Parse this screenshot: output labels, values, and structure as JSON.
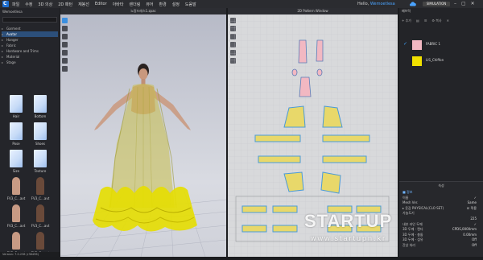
{
  "menubar": {
    "menus": [
      "파일",
      "수정",
      "3D 의상",
      "2D 패턴",
      "재봉선",
      "Editor",
      "아바타",
      "렌더링",
      "뷰어",
      "환경",
      "설정",
      "도움말"
    ],
    "user_greeting": "Hello, ",
    "user_name": "Wemoetlesa",
    "sim_button": "SIMULATION",
    "accent": "#1f6fd1"
  },
  "library": {
    "header": "Wemoetlesa",
    "tree": [
      "Garment",
      "Avatar",
      "Hanger",
      "Fabric",
      "Hardware and Trims",
      "Material",
      "Stage"
    ],
    "selected": "Avatar",
    "thumbs": [
      {
        "label": "Hair",
        "type": "file"
      },
      {
        "label": "Bottom",
        "type": "file"
      },
      {
        "label": "Pose",
        "type": "file"
      },
      {
        "label": "Shoes",
        "type": "file"
      },
      {
        "label": "Size",
        "type": "file"
      },
      {
        "label": "Texture",
        "type": "file"
      },
      {
        "label": "FV3_C...avt",
        "type": "avatar"
      },
      {
        "label": "FV3_C...avt",
        "type": "avatar"
      },
      {
        "label": "FV3_C...avt",
        "type": "avatar"
      },
      {
        "label": "FV3_C...avt",
        "type": "avatar"
      },
      {
        "label": "FV3_C...avt",
        "type": "avatar"
      },
      {
        "label": "FV3_C...avt",
        "type": "avatar"
      }
    ],
    "status": "Version: 7.0.238 (r38496)"
  },
  "viewport3d": {
    "title": "노랑드레스1.zpac",
    "toolbar_icons": [
      "select-icon",
      "move-icon",
      "pin-icon",
      "fold-icon",
      "brush-icon",
      "fabric-icon",
      "avatar-icon"
    ]
  },
  "viewport2d": {
    "title": "2D Pattern Window",
    "toolbar_icons": [
      "transform-icon",
      "edit-point-icon",
      "curve-icon",
      "seam-icon",
      "texture-icon",
      "pin-icon"
    ]
  },
  "object_browser": {
    "header": "패브릭",
    "tabs": [
      "+ 추가",
      "▤",
      "☰",
      "⚙ 복사",
      "✕"
    ],
    "fabrics": [
      {
        "name": "FABRIC 1",
        "color": "#f2b8c2",
        "checked": true
      },
      {
        "name": "LIS_Chiffon",
        "color": "#f0e000",
        "checked": false
      }
    ]
  },
  "property_editor": {
    "header": "속성",
    "rows": [
      {
        "label": "■ 정보",
        "value": "",
        "section": true
      },
      {
        "label": "이름",
        "value": "✓"
      },
      {
        "label": "Mesh Ver.",
        "value": "Same"
      },
      {
        "label": "▸ 옷감 PHYSICAL(CLO SET)",
        "value": "☑ 적용"
      },
      {
        "label": "가늘도기",
        "value": ""
      },
      {
        "label": "",
        "value": "225"
      },
      {
        "label": "내부 라인 두께",
        "value": "✓"
      },
      {
        "label": "3D 두께 - 렌더",
        "value": "CPDS,0000mm"
      },
      {
        "label": "3D 두께 - 충돌",
        "value": "0.00mm"
      },
      {
        "label": "3D 두께 - 섬유",
        "value": "Off"
      },
      {
        "label": "잔상 처리",
        "value": "Off"
      }
    ]
  },
  "watermark": {
    "brand": "STARTUP",
    "url": "www.startupn.kr"
  }
}
